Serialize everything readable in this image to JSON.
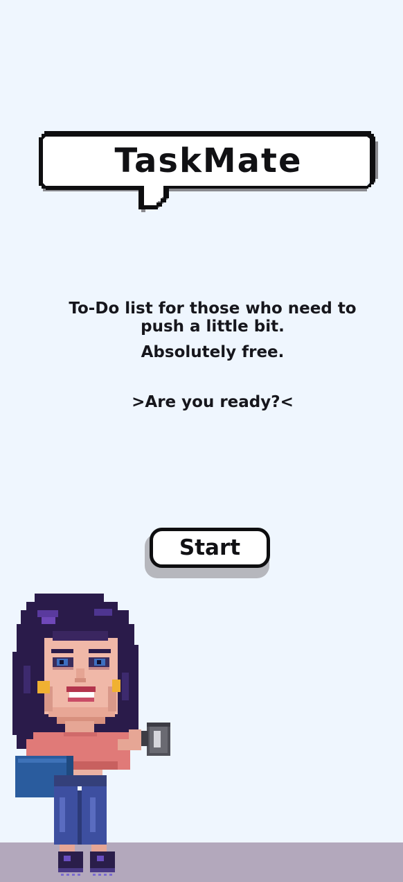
{
  "app": {
    "title": "TaskMate"
  },
  "intro": {
    "description_line1": "To-Do list for those who need to",
    "description_line2": "push a little bit.",
    "pricing": "Absolutely free.",
    "prompt": ">Are you ready?<"
  },
  "actions": {
    "start_label": "Start"
  },
  "colors": {
    "background": "#eff6fe",
    "ground": "#b3a8bc",
    "text": "#121217",
    "bubble_border": "#0e0e10",
    "bubble_shadow": "#8a8a8f",
    "button_shadow": "#b6b7bd",
    "hair": "#2a1b4a",
    "shirt": "#e07a78",
    "jeans": "#3d4fa0"
  },
  "icons": {
    "speech_bubble": "pixel-speech-bubble-icon",
    "character": "pixel-girl-with-coffee-illustration"
  }
}
